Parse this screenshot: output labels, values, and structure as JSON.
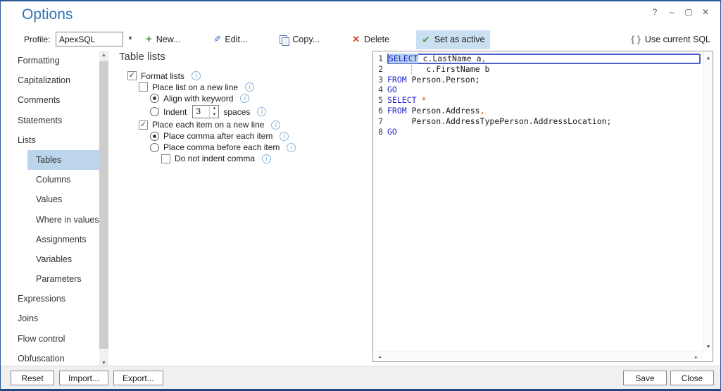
{
  "window": {
    "title": "Options",
    "controls": [
      {
        "name": "help",
        "glyph": "?"
      },
      {
        "name": "minimize",
        "glyph": "–"
      },
      {
        "name": "maximize",
        "glyph": "▢"
      },
      {
        "name": "close",
        "glyph": "✕"
      }
    ]
  },
  "toolbar": {
    "profile_label": "Profile:",
    "profile_value": "ApexSQL",
    "buttons": [
      {
        "icon": "plus-icon",
        "label": "New...",
        "active": false
      },
      {
        "icon": "pencil-icon",
        "label": "Edit...",
        "active": false
      },
      {
        "icon": "copy-icon",
        "label": "Copy...",
        "active": false
      },
      {
        "icon": "delete-icon",
        "label": "Delete",
        "active": false
      },
      {
        "icon": "check-icon",
        "label": "Set as active",
        "active": true
      }
    ],
    "use_current_sql": {
      "icon": "braces-icon",
      "label": "Use current SQL"
    }
  },
  "sidebar": {
    "items": [
      {
        "label": "Formatting",
        "level": 0,
        "selected": false
      },
      {
        "label": "Capitalization",
        "level": 0,
        "selected": false
      },
      {
        "label": "Comments",
        "level": 0,
        "selected": false
      },
      {
        "label": "Statements",
        "level": 0,
        "selected": false
      },
      {
        "label": "Lists",
        "level": 0,
        "selected": false
      },
      {
        "label": "Tables",
        "level": 1,
        "selected": true
      },
      {
        "label": "Columns",
        "level": 1,
        "selected": false
      },
      {
        "label": "Values",
        "level": 1,
        "selected": false
      },
      {
        "label": "Where in values",
        "level": 1,
        "selected": false
      },
      {
        "label": "Assignments",
        "level": 1,
        "selected": false
      },
      {
        "label": "Variables",
        "level": 1,
        "selected": false
      },
      {
        "label": "Parameters",
        "level": 1,
        "selected": false
      },
      {
        "label": "Expressions",
        "level": 0,
        "selected": false
      },
      {
        "label": "Joins",
        "level": 0,
        "selected": false
      },
      {
        "label": "Flow control",
        "level": 0,
        "selected": false
      },
      {
        "label": "Obfuscation",
        "level": 0,
        "selected": false
      }
    ]
  },
  "options": {
    "heading": "Table lists",
    "rows": [
      {
        "type": "checkbox",
        "label": "Format lists",
        "checked": true,
        "level": 0,
        "info": true
      },
      {
        "type": "checkbox",
        "label": "Place list on a new line",
        "checked": false,
        "level": 1,
        "info": true
      },
      {
        "type": "radio",
        "label": "Align with keyword",
        "checked": true,
        "level": 2,
        "info": true
      },
      {
        "type": "radio-spinner",
        "label": "Indent",
        "value": "3",
        "suffix": "spaces",
        "checked": false,
        "level": 2,
        "info": true
      },
      {
        "type": "checkbox",
        "label": "Place each item on a new line",
        "checked": true,
        "level": 1,
        "info": true
      },
      {
        "type": "radio",
        "label": "Place comma after each item",
        "checked": true,
        "level": 2,
        "info": true
      },
      {
        "type": "radio",
        "label": "Place comma before each item",
        "checked": false,
        "level": 2,
        "info": true
      },
      {
        "type": "checkbox",
        "label": "Do not indent comma",
        "checked": false,
        "level": 3,
        "info": true
      }
    ]
  },
  "sql_preview": {
    "lines": [
      {
        "num": "1",
        "selected": true,
        "indent_guide": false,
        "segments": [
          {
            "text": "SELECT",
            "color": "keyword",
            "highlight": true
          },
          {
            "text": " c.LastName a",
            "color": "ident"
          },
          {
            "text": ",",
            "color": "punct"
          }
        ]
      },
      {
        "num": "2",
        "selected": false,
        "indent_guide": true,
        "segments": [
          {
            "text": "        c.FirstName b",
            "color": "ident"
          }
        ]
      },
      {
        "num": "3",
        "selected": false,
        "indent_guide": false,
        "segments": [
          {
            "text": "FROM",
            "color": "keyword"
          },
          {
            "text": " Person.Person;",
            "color": "ident"
          }
        ]
      },
      {
        "num": "4",
        "selected": false,
        "indent_guide": false,
        "segments": [
          {
            "text": "GO",
            "color": "keyword"
          }
        ]
      },
      {
        "num": "5",
        "selected": false,
        "indent_guide": false,
        "segments": [
          {
            "text": "SELECT",
            "color": "keyword"
          },
          {
            "text": " ",
            "color": "ident"
          },
          {
            "text": "*",
            "color": "punct"
          }
        ]
      },
      {
        "num": "6",
        "selected": false,
        "indent_guide": false,
        "segments": [
          {
            "text": "FROM",
            "color": "keyword"
          },
          {
            "text": " Person.Address",
            "color": "ident"
          },
          {
            "text": ",",
            "color": "punct"
          }
        ]
      },
      {
        "num": "7",
        "selected": false,
        "indent_guide": false,
        "segments": [
          {
            "text": "     Person.AddressTypePerson.AddressLocation;",
            "color": "ident"
          }
        ]
      },
      {
        "num": "8",
        "selected": false,
        "indent_guide": false,
        "segments": [
          {
            "text": "GO",
            "color": "keyword"
          }
        ]
      }
    ]
  },
  "footer": {
    "left_buttons": [
      "Reset",
      "Import...",
      "Export..."
    ],
    "right_buttons": [
      "Save",
      "Close"
    ]
  },
  "colors": {
    "keyword": "#2323cc",
    "ident": "#1a1a1a",
    "punct": "#c65911",
    "accent_blue": "#2e75b6",
    "sidebar_selection": "#bcd4ec",
    "active_button_bg": "#cbdff2",
    "window_border": "#2b5797"
  }
}
